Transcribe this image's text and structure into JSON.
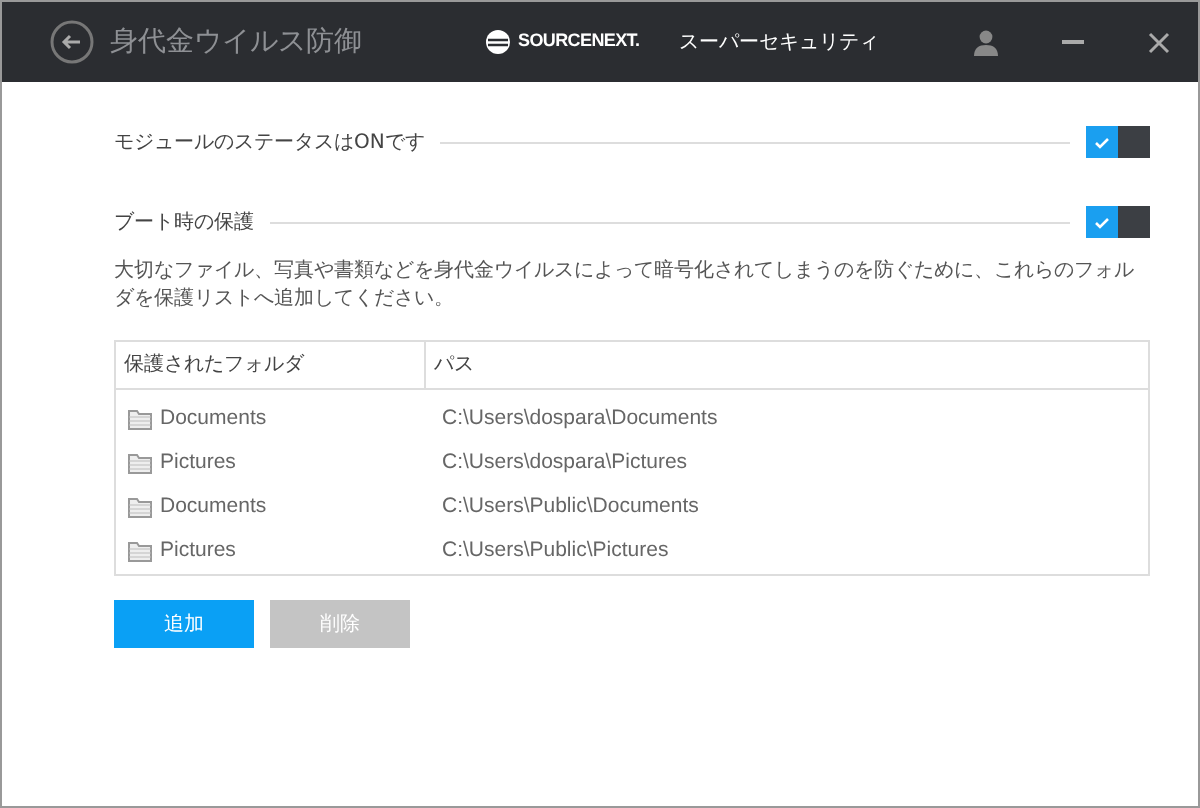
{
  "window": {
    "title": "身代金ウイルス防御",
    "brand": "SOURCENEXT.",
    "product": "スーパーセキュリティ"
  },
  "settings": [
    {
      "label": "モジュールのステータスはONです",
      "checked": true
    },
    {
      "label": "ブート時の保護",
      "checked": true
    }
  ],
  "description": "大切なファイル、写真や書類などを身代金ウイルスによって暗号化されてしまうのを防ぐために、これらのフォルダを保護リストへ追加してください。",
  "table": {
    "columns": [
      "保護されたフォルダ",
      "パス"
    ],
    "rows": [
      {
        "folder": "Documents",
        "path": "C:\\Users\\dospara\\Documents"
      },
      {
        "folder": "Pictures",
        "path": "C:\\Users\\dospara\\Pictures"
      },
      {
        "folder": "Documents",
        "path": "C:\\Users\\Public\\Documents"
      },
      {
        "folder": "Pictures",
        "path": "C:\\Users\\Public\\Pictures"
      }
    ]
  },
  "buttons": [
    {
      "label": "追加",
      "disabled": false
    },
    {
      "label": "削除",
      "disabled": true
    }
  ]
}
